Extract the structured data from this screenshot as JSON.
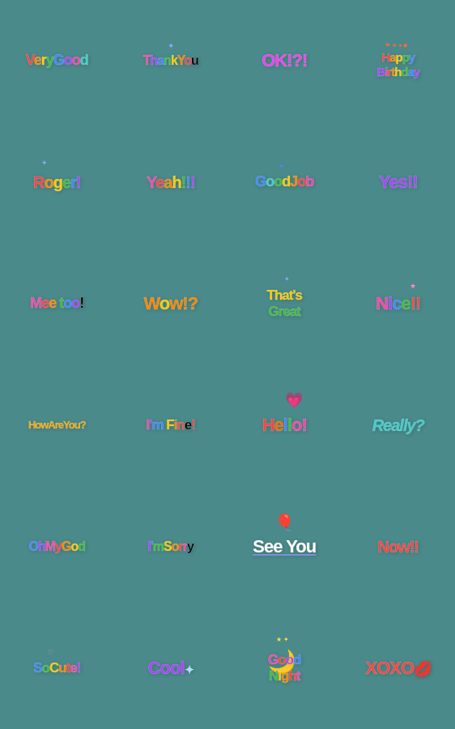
{
  "stickers": [
    {
      "id": "very-good",
      "text": "VeryGood",
      "row": 1,
      "col": 1
    },
    {
      "id": "thank-you",
      "text": "ThankYou",
      "row": 1,
      "col": 2
    },
    {
      "id": "ok",
      "text": "OK!?!",
      "row": 1,
      "col": 3
    },
    {
      "id": "happy-birthday",
      "text": "Happy Birthday",
      "row": 1,
      "col": 4
    },
    {
      "id": "roger",
      "text": "Roger!",
      "row": 2,
      "col": 1
    },
    {
      "id": "yeah",
      "text": "Yeah!!!",
      "row": 2,
      "col": 2
    },
    {
      "id": "good-job",
      "text": "GoodJob",
      "row": 2,
      "col": 3
    },
    {
      "id": "yes",
      "text": "Yes!!",
      "row": 2,
      "col": 4
    },
    {
      "id": "me-too",
      "text": "Mee too!",
      "row": 3,
      "col": 1
    },
    {
      "id": "wow",
      "text": "Wow!?",
      "row": 3,
      "col": 2
    },
    {
      "id": "thats-great",
      "text": "That's Great",
      "row": 3,
      "col": 3
    },
    {
      "id": "nice",
      "text": "Nice!!",
      "row": 3,
      "col": 4
    },
    {
      "id": "how-are-you",
      "text": "HowAreYou?",
      "row": 4,
      "col": 1
    },
    {
      "id": "im-fine",
      "text": "I'm Fine!",
      "row": 4,
      "col": 2
    },
    {
      "id": "hello",
      "text": "Hello!",
      "row": 4,
      "col": 3
    },
    {
      "id": "really",
      "text": "Really?",
      "row": 4,
      "col": 4
    },
    {
      "id": "oh-my-god",
      "text": "Oh My God",
      "row": 5,
      "col": 1
    },
    {
      "id": "im-sorry",
      "text": "I'm Sorry",
      "row": 5,
      "col": 2
    },
    {
      "id": "see-you",
      "text": "See You",
      "row": 5,
      "col": 3
    },
    {
      "id": "now",
      "text": "Now!!",
      "row": 5,
      "col": 4
    },
    {
      "id": "so-cute",
      "text": "So Cute!",
      "row": 6,
      "col": 1
    },
    {
      "id": "cool",
      "text": "Cool",
      "row": 6,
      "col": 2
    },
    {
      "id": "good-night",
      "text": "Good Night",
      "row": 6,
      "col": 3
    },
    {
      "id": "xoxo",
      "text": "XOXO",
      "row": 6,
      "col": 4
    }
  ]
}
